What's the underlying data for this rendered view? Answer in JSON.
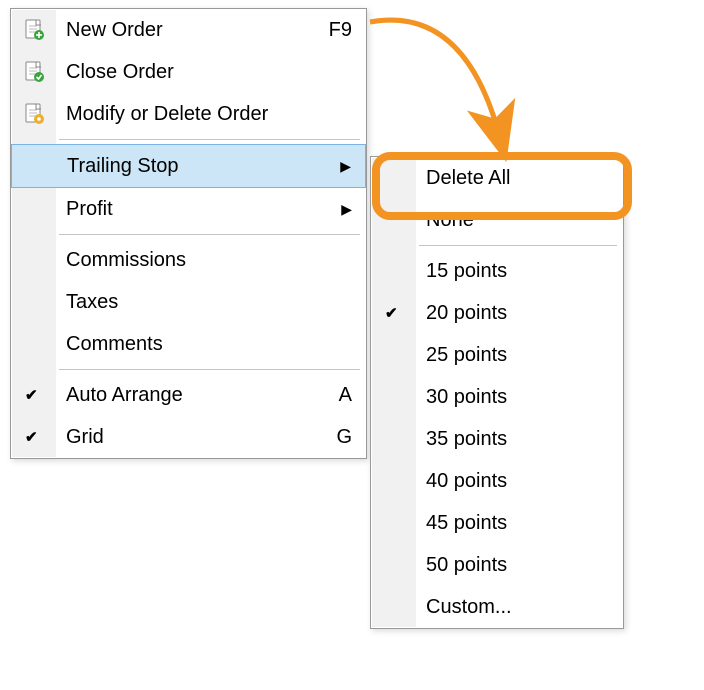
{
  "main_menu": {
    "new_order": {
      "label": "New Order",
      "shortcut": "F9"
    },
    "close_order": {
      "label": "Close Order"
    },
    "modify_order": {
      "label": "Modify or Delete Order"
    },
    "trailing_stop": {
      "label": "Trailing Stop"
    },
    "profit": {
      "label": "Profit"
    },
    "commissions": {
      "label": "Commissions"
    },
    "taxes": {
      "label": "Taxes"
    },
    "comments": {
      "label": "Comments"
    },
    "auto_arrange": {
      "label": "Auto Arrange",
      "shortcut": "A"
    },
    "grid": {
      "label": "Grid",
      "shortcut": "G"
    }
  },
  "sub_menu": {
    "delete_all": "Delete All",
    "none": "None",
    "p15": "15 points",
    "p20": "20 points",
    "p25": "25 points",
    "p30": "30 points",
    "p35": "35 points",
    "p40": "40 points",
    "p45": "45 points",
    "p50": "50 points",
    "custom": "Custom..."
  },
  "colors": {
    "accent": "#f39322",
    "highlight": "#cde6f7"
  }
}
